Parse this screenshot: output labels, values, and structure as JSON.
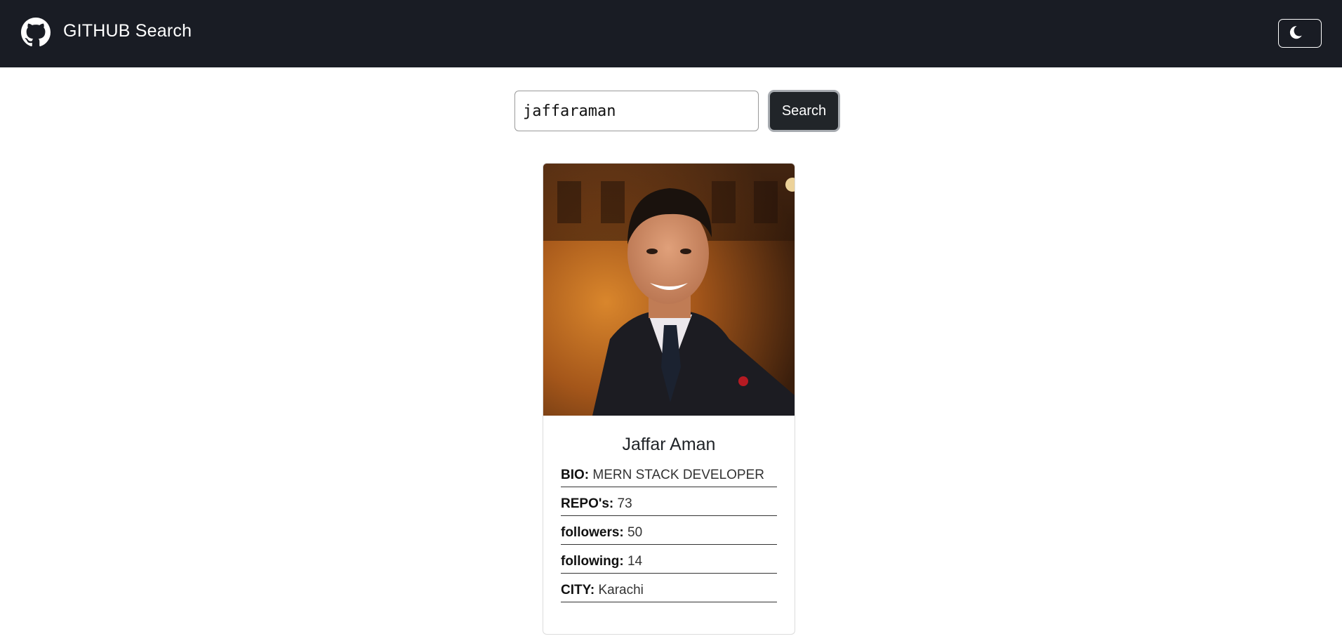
{
  "navbar": {
    "title": "GITHUB Search",
    "logo_icon": "github-icon",
    "theme_toggle_icon": "moon-icon",
    "background": "#191c24"
  },
  "search": {
    "value": "jaffaraman",
    "button_label": "Search"
  },
  "profile": {
    "name": "Jaffar Aman",
    "avatar_description": "profile-photo",
    "fields": [
      {
        "label": "BIO:",
        "value": "MERN STACK DEVELOPER"
      },
      {
        "label": "REPO's:",
        "value": "73"
      },
      {
        "label": "followers:",
        "value": "50"
      },
      {
        "label": "following:",
        "value": "14"
      },
      {
        "label": "CITY:",
        "value": "Karachi"
      }
    ]
  },
  "colors": {
    "accent_dark": "#212529",
    "page_background": "#ffffff"
  }
}
